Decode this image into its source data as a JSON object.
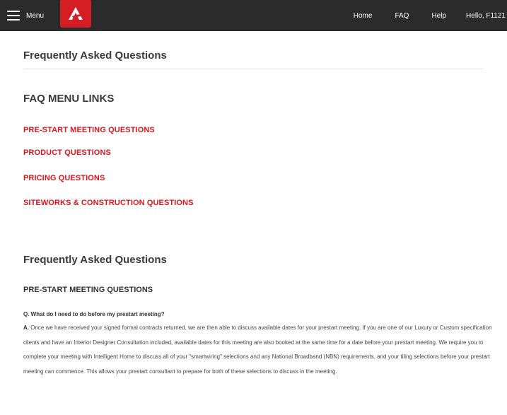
{
  "topbar": {
    "menu_label": "Menu",
    "logo_icon": "brand-logo",
    "brand_color": "#d51e23",
    "nav": {
      "home": "Home",
      "faq": "FAQ",
      "help": "Help",
      "greeting": "Hello, F1121"
    }
  },
  "page": {
    "title": "Frequently Asked Questions",
    "links_heading": "FAQ MENU LINKS",
    "links": [
      "PRE-START MEETING QUESTIONS",
      "PRODUCT QUESTIONS",
      "PRICING QUESTIONS",
      "SITEWORKS & CONSTRUCTION QUESTIONS"
    ],
    "link_color": "#e0141c"
  },
  "faq": {
    "section_title": "Frequently Asked Questions",
    "subsection_title": "PRE-START MEETING QUESTIONS",
    "items": [
      {
        "question": "Q. What do I need to do before my prestart meeting?",
        "answer_prefix": "A.",
        "answer": "Once we have received your signed formal contracts returned, we are then able to discuss available dates for your prestart meeting. If you are one of our Luxury or Custom specification clients and have an Interior Designer Consultation included, available dates for this meeting are also booked at the same time for a date before your prestart meeting. We require you to complete your meeting with Intelligent Home to discuss all of your \"smartwiring\" selections and any National Broadband (NBN) requirements, and your tiling selections before your prestart meeting can commence. This allows your prestart consultant to prepare for both of these selections to discuss in the meeting."
      }
    ]
  }
}
